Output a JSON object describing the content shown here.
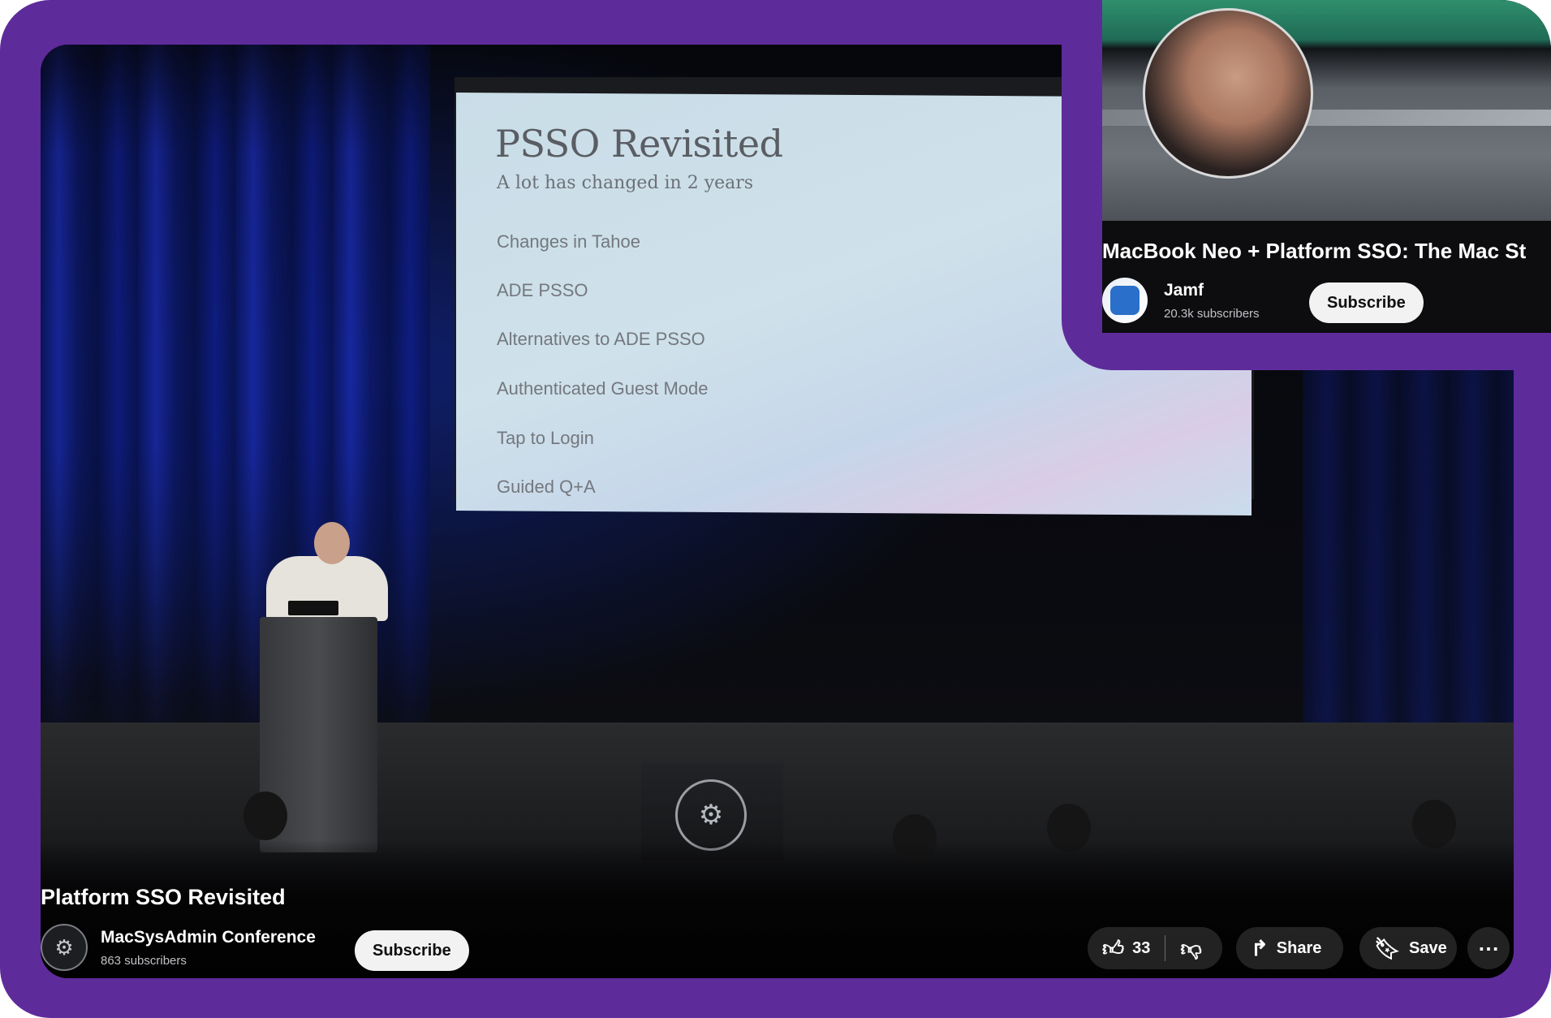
{
  "main_video": {
    "slide": {
      "title": "PSSO Revisited",
      "subtitle": "A lot has changed in 2 years",
      "items": [
        "Changes in Tahoe",
        "ADE PSSO",
        "Alternatives to ADE PSSO",
        "Authenticated Guest Mode",
        "Tap to Login",
        "Guided Q+A"
      ]
    },
    "title": "Platform SSO Revisited",
    "channel": {
      "name": "MacSysAdmin Conference",
      "subscribers": "863 subscribers"
    },
    "subscribe_label": "Subscribe",
    "actions": {
      "like_count": "33",
      "share_label": "Share",
      "save_label": "Save"
    }
  },
  "mini_video": {
    "title": "MacBook Neo + Platform SSO: The Mac St",
    "channel": {
      "name": "Jamf",
      "subscribers": "20.3k subscribers"
    },
    "subscribe_label": "Subscribe"
  },
  "icons": {
    "like": "thumbs-up-icon",
    "dislike": "thumbs-down-icon",
    "share": "share-arrow-icon",
    "save": "bookmark-icon",
    "more": "more-horizontal-icon"
  },
  "colors": {
    "frame_purple": "#5e2b9a",
    "pill_bg": "rgba(255,255,255,0.13)",
    "subscribe_bg": "#f2f2f2"
  }
}
